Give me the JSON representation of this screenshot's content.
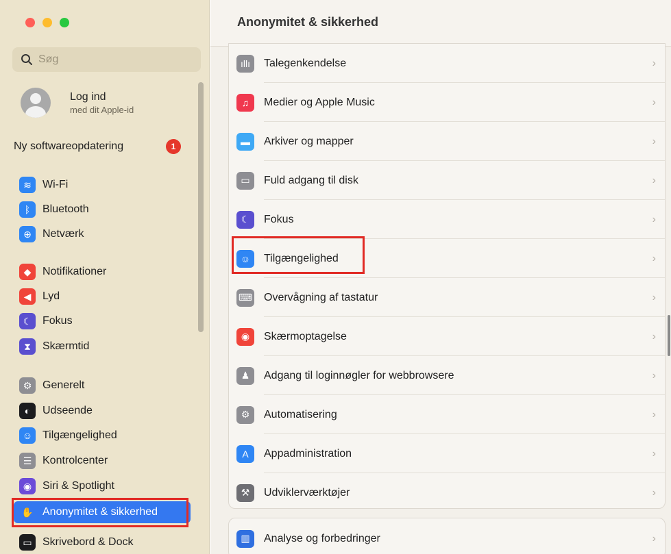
{
  "banner": {
    "text": ""
  },
  "search": {
    "placeholder": "Søg"
  },
  "account": {
    "name": "Log ind",
    "subtitle": "med dit Apple-id"
  },
  "update": {
    "label": "Ny softwareopdatering",
    "count": "1"
  },
  "sidebar": {
    "items": [
      {
        "label": "Wi-Fi",
        "icon": "wifi-icon",
        "color": "#2f86f4",
        "glyph": "≋"
      },
      {
        "label": "Bluetooth",
        "icon": "bluetooth-icon",
        "color": "#2f86f4",
        "glyph": "ᛒ"
      },
      {
        "label": "Netværk",
        "icon": "globe-icon",
        "color": "#2f86f4",
        "glyph": "⊕"
      },
      {
        "label": "Notifikationer",
        "icon": "bell-icon",
        "color": "#f0443a",
        "glyph": "◆"
      },
      {
        "label": "Lyd",
        "icon": "speaker-icon",
        "color": "#f0443a",
        "glyph": "◀"
      },
      {
        "label": "Fokus",
        "icon": "moon-icon",
        "color": "#5a4fcf",
        "glyph": "☾"
      },
      {
        "label": "Skærmtid",
        "icon": "hourglass-icon",
        "color": "#5a4fcf",
        "glyph": "⧗"
      },
      {
        "label": "Generelt",
        "icon": "gear-icon",
        "color": "#8e8e93",
        "glyph": "⚙"
      },
      {
        "label": "Udseende",
        "icon": "appearance-icon",
        "color": "#1c1c1e",
        "glyph": "◐"
      },
      {
        "label": "Tilgængelighed",
        "icon": "accessibility-icon",
        "color": "#2f86f4",
        "glyph": "☺"
      },
      {
        "label": "Kontrolcenter",
        "icon": "toggles-icon",
        "color": "#8e8e93",
        "glyph": "☰"
      },
      {
        "label": "Siri & Spotlight",
        "icon": "siri-icon",
        "color": "#6b4bd8",
        "glyph": "◉"
      },
      {
        "label": "Anonymitet & sikkerhed",
        "icon": "hand-icon",
        "color": "#3478f0",
        "glyph": "✋"
      },
      {
        "label": "Skrivebord & Dock",
        "icon": "dock-icon",
        "color": "#1c1c1e",
        "glyph": "▭"
      }
    ]
  },
  "main": {
    "title": "Anonymitet & sikkerhed",
    "rows": [
      {
        "label": "Talegenkendelse",
        "icon": "waveform-icon",
        "color": "#8e8e93",
        "glyph": "ıllı"
      },
      {
        "label": "Medier og Apple Music",
        "icon": "music-icon",
        "color": "#f0384e",
        "glyph": "♫"
      },
      {
        "label": "Arkiver og mapper",
        "icon": "folder-icon",
        "color": "#3fa9f5",
        "glyph": "▬"
      },
      {
        "label": "Fuld adgang til disk",
        "icon": "disk-icon",
        "color": "#8e8e93",
        "glyph": "▭"
      },
      {
        "label": "Fokus",
        "icon": "moon-icon",
        "color": "#5a4fcf",
        "glyph": "☾"
      },
      {
        "label": "Tilgængelighed",
        "icon": "accessibility-icon",
        "color": "#2f86f4",
        "glyph": "☺"
      },
      {
        "label": "Overvågning af tastatur",
        "icon": "keyboard-icon",
        "color": "#8e8e93",
        "glyph": "⌨"
      },
      {
        "label": "Skærmoptagelse",
        "icon": "record-icon",
        "color": "#f0443a",
        "glyph": "◉"
      },
      {
        "label": "Adgang til loginnøgler for webbrowsere",
        "icon": "person-key-icon",
        "color": "#8e8e93",
        "glyph": "♟"
      },
      {
        "label": "Automatisering",
        "icon": "gears-icon",
        "color": "#8e8e93",
        "glyph": "⚙"
      },
      {
        "label": "Appadministration",
        "icon": "appstore-icon",
        "color": "#2f86f4",
        "glyph": "A"
      },
      {
        "label": "Udviklerværktøjer",
        "icon": "hammer-icon",
        "color": "#6e6e73",
        "glyph": "⚒"
      }
    ],
    "bottom_row": {
      "label": "Analyse og forbedringer",
      "icon": "chart-icon",
      "color": "#2f6fe0",
      "glyph": "▥"
    },
    "chevron": "›"
  }
}
